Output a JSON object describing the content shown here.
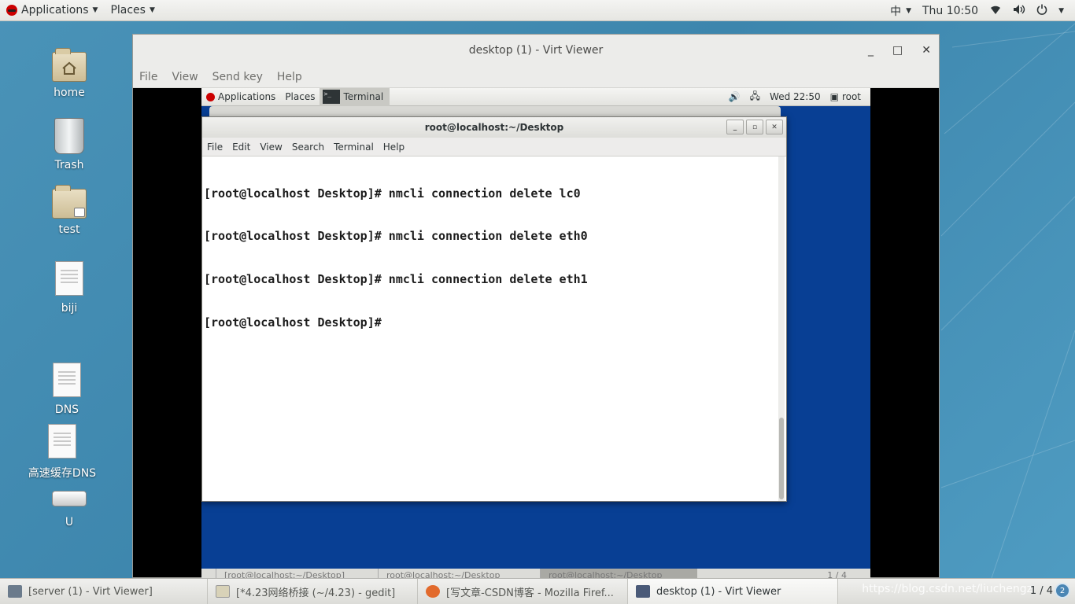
{
  "host_topbar": {
    "applications": "Applications",
    "places": "Places",
    "input_method": "中",
    "clock": "Thu 10:50"
  },
  "desktop": {
    "icons": [
      {
        "label": "home",
        "kind": "home-folder"
      },
      {
        "label": "Trash",
        "kind": "trash"
      },
      {
        "label": "test",
        "kind": "locked-folder"
      },
      {
        "label": "biji",
        "kind": "document"
      },
      {
        "label": "DNS",
        "kind": "document"
      },
      {
        "label": "高速缓存DNS",
        "kind": "document"
      },
      {
        "label": "U",
        "kind": "drive"
      }
    ]
  },
  "virt_viewer": {
    "title": "desktop (1) - Virt Viewer",
    "menu": [
      "File",
      "View",
      "Send key",
      "Help"
    ],
    "guest": {
      "topbar": {
        "applications": "Applications",
        "places": "Places",
        "terminal": "Terminal",
        "clock": "Wed 22:50",
        "user": "root"
      },
      "background_window_title": "root@localhost:~/Desktop",
      "terminal": {
        "title": "root@localhost:~/Desktop",
        "menu": [
          "File",
          "Edit",
          "View",
          "Search",
          "Terminal",
          "Help"
        ],
        "lines": [
          "[root@localhost Desktop]# nmcli connection delete lc0",
          "[root@localhost Desktop]# nmcli connection delete eth0",
          "[root@localhost Desktop]# nmcli connection delete eth1",
          "[root@localhost Desktop]# "
        ]
      },
      "taskbar": {
        "tasks": [
          "[root@localhost:~/Desktop]",
          "root@localhost:~/Desktop",
          "root@localhost:~/Desktop"
        ],
        "pager": "1 / 4"
      }
    }
  },
  "host_taskbar": {
    "tasks": [
      {
        "label": "[server (1) - Virt Viewer]",
        "icon": "virt-viewer-icon",
        "color": "#6b7b8c"
      },
      {
        "label": "[*4.23网络桥接 (~/4.23) - gedit]",
        "icon": "gedit-icon",
        "color": "#d8d2b8"
      },
      {
        "label": "[写文章-CSDN博客 - Mozilla Firef...",
        "icon": "firefox-icon",
        "color": "#e26a2c"
      },
      {
        "label": "desktop (1) - Virt Viewer",
        "icon": "virt-viewer-icon",
        "color": "#4a5a78"
      }
    ],
    "watermark": "https://blog.csdn.net/liuchengz",
    "pager": "1 / 4"
  },
  "colors": {
    "desktop_bg": "#4a93b8",
    "guest_bg": "#083f94",
    "accent_red": "#cc0000"
  }
}
